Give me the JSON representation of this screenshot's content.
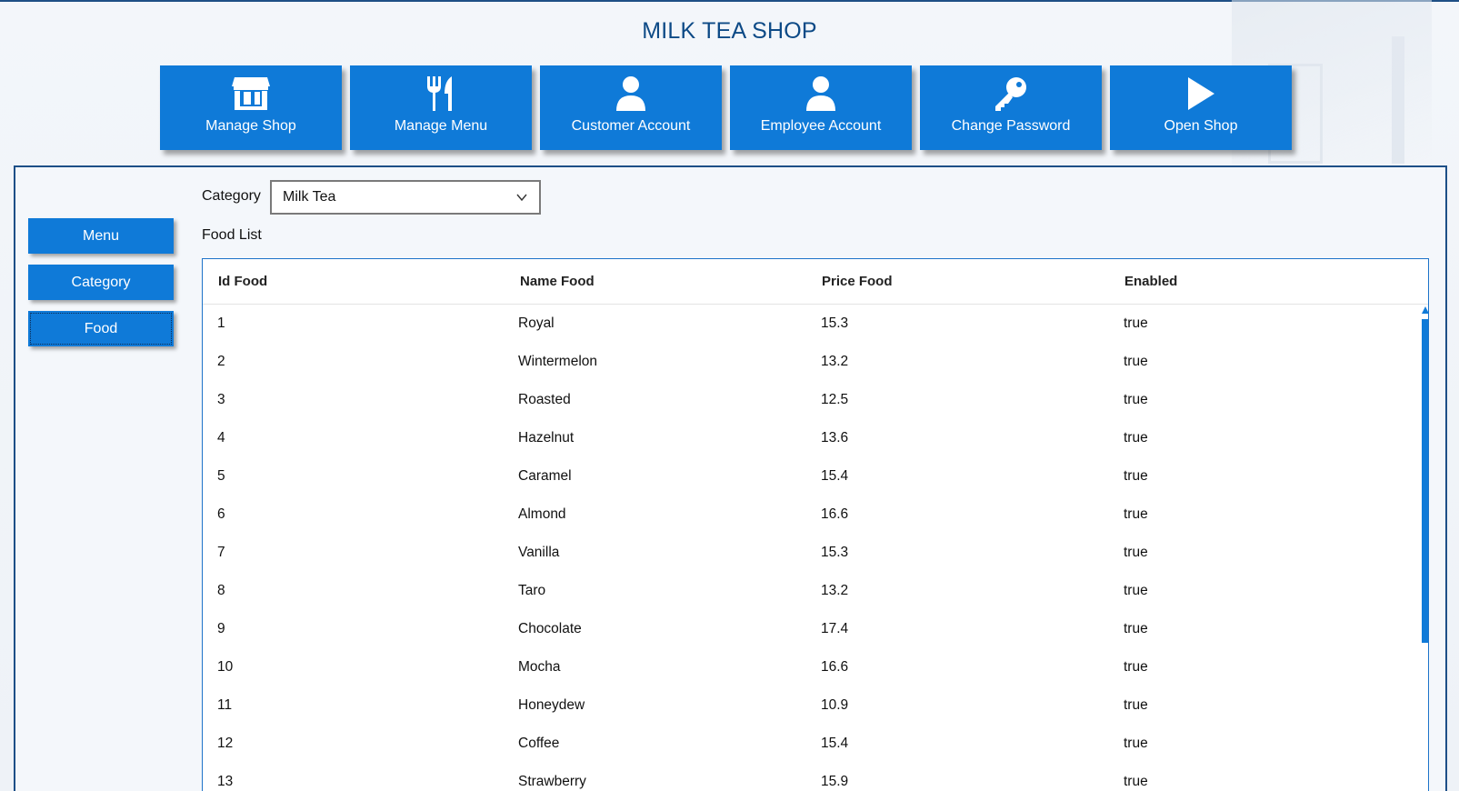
{
  "app": {
    "title": "MILK TEA SHOP"
  },
  "toolbar": {
    "buttons": [
      {
        "label": "Manage Shop",
        "icon": "shop-icon"
      },
      {
        "label": "Manage Menu",
        "icon": "utensils-icon"
      },
      {
        "label": "Customer Account",
        "icon": "user-icon"
      },
      {
        "label": "Employee Account",
        "icon": "user-icon"
      },
      {
        "label": "Change Password",
        "icon": "key-icon"
      },
      {
        "label": "Open Shop",
        "icon": "play-icon"
      }
    ]
  },
  "sidebar": {
    "items": [
      {
        "label": "Menu"
      },
      {
        "label": "Category"
      },
      {
        "label": "Food",
        "active": true
      }
    ]
  },
  "filter": {
    "category_label": "Category",
    "category_value": "Milk Tea"
  },
  "food_list": {
    "label": "Food List",
    "columns": [
      "Id Food",
      "Name Food",
      "Price Food",
      "Enabled"
    ],
    "rows": [
      [
        "1",
        "Royal",
        "15.3",
        "true"
      ],
      [
        "2",
        "Wintermelon",
        "13.2",
        "true"
      ],
      [
        "3",
        "Roasted",
        "12.5",
        "true"
      ],
      [
        "4",
        "Hazelnut",
        "13.6",
        "true"
      ],
      [
        "5",
        "Caramel",
        "15.4",
        "true"
      ],
      [
        "6",
        "Almond",
        "16.6",
        "true"
      ],
      [
        "7",
        "Vanilla",
        "15.3",
        "true"
      ],
      [
        "8",
        "Taro",
        "13.2",
        "true"
      ],
      [
        "9",
        "Chocolate",
        "17.4",
        "true"
      ],
      [
        "10",
        "Mocha",
        "16.6",
        "true"
      ],
      [
        "11",
        "Honeydew",
        "10.9",
        "true"
      ],
      [
        "12",
        "Coffee",
        "15.4",
        "true"
      ],
      [
        "13",
        "Strawberry",
        "15.9",
        "true"
      ]
    ]
  },
  "colors": {
    "accent": "#0f7ad8",
    "title": "#0d4a86",
    "border": "#1d4f87"
  }
}
